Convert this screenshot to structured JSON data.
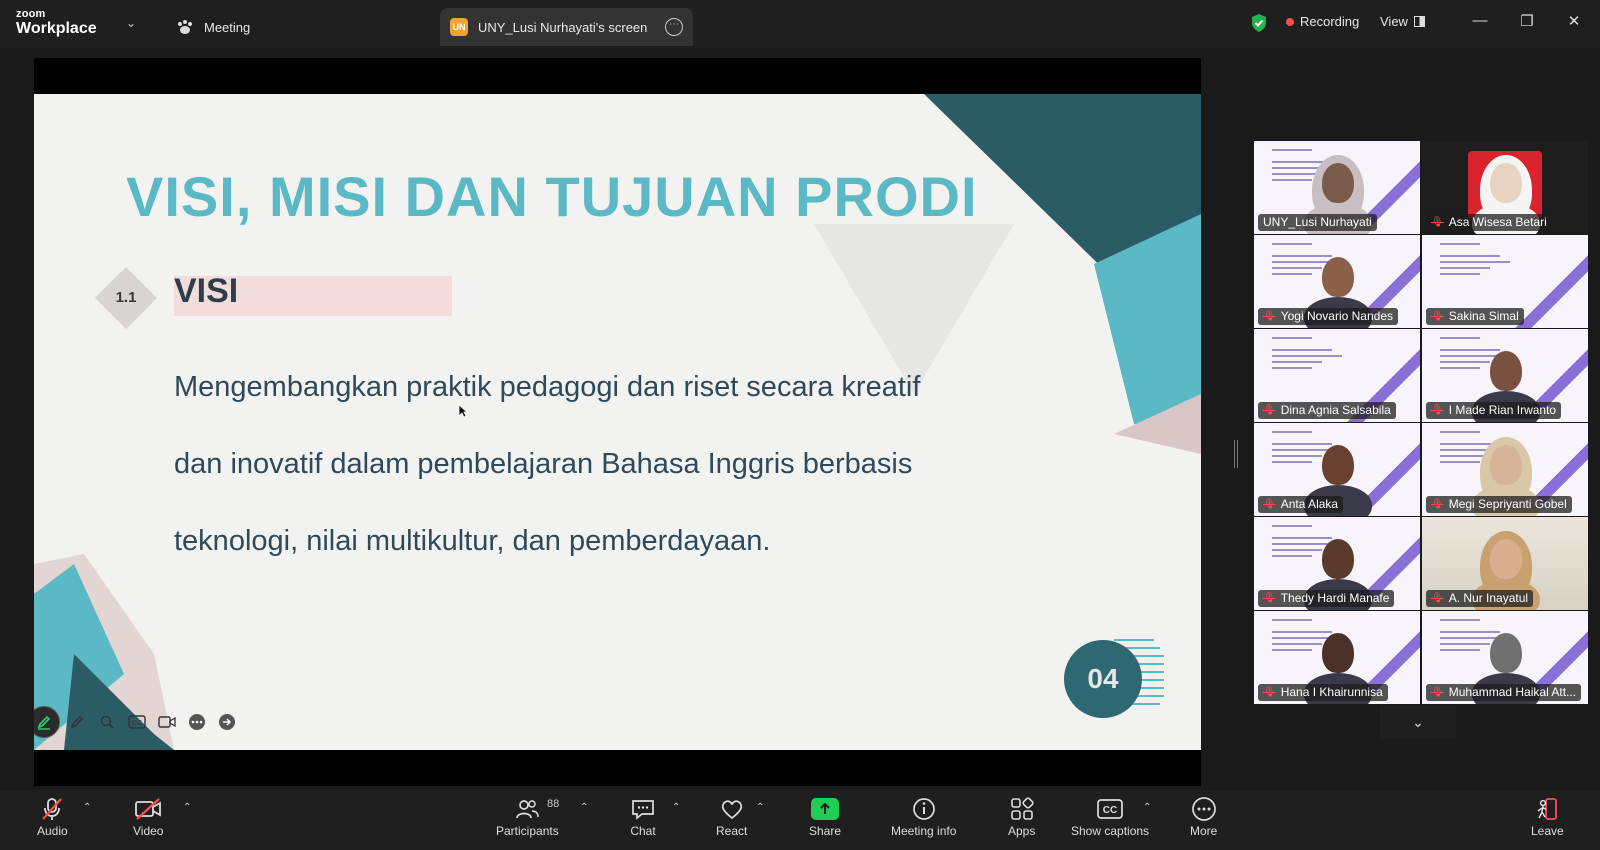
{
  "app": {
    "brand_top": "zoom",
    "brand_bottom": "Workplace"
  },
  "tabs": {
    "meeting": "Meeting",
    "screen_badge": "UN",
    "screen": "UNY_Lusi Nurhayati's screen"
  },
  "status": {
    "recording": "Recording",
    "view": "View"
  },
  "slide": {
    "title": "VISI, MISI DAN TUJUAN PRODI",
    "section_number": "1.1",
    "section_label": "VISI",
    "lines": [
      "Mengembangkan praktik pedagogi dan riset secara kreatif",
      "dan inovatif dalam pembelajaran Bahasa Inggris berbasis",
      "teknologi, nilai multikultur, dan pemberdayaan."
    ],
    "page_number": "04"
  },
  "participants": [
    {
      "name": "UNY_Lusi Nurhayati",
      "muted": false
    },
    {
      "name": "Asa Wisesa Betari",
      "muted": true
    },
    {
      "name": "Yogi Novario Nandes",
      "muted": true
    },
    {
      "name": "Sakina Simal",
      "muted": true
    },
    {
      "name": "Dina Agnia Salsabila",
      "muted": true
    },
    {
      "name": "I Made Rian Irwanto",
      "muted": true
    },
    {
      "name": "Anta Alaka",
      "muted": true
    },
    {
      "name": "Megi Sepriyanti Gobel",
      "muted": true
    },
    {
      "name": "Thedy Hardi Manafe",
      "muted": true
    },
    {
      "name": "A. Nur Inayatul",
      "muted": true
    },
    {
      "name": "Hana I Khairunnisa",
      "muted": true
    },
    {
      "name": "Muhammad Haikal Att...",
      "muted": true
    }
  ],
  "toolbar": {
    "audio": "Audio",
    "video": "Video",
    "participants": "Participants",
    "participants_count": "88",
    "chat": "Chat",
    "react": "React",
    "share": "Share",
    "meeting_info": "Meeting info",
    "apps": "Apps",
    "captions": "Show captions",
    "more": "More",
    "leave": "Leave"
  },
  "colors": {
    "accent": "#5ab9c4",
    "active_speaker": "#2fd26b",
    "share_green": "#1fcf55",
    "mute_red": "#ff4d4d"
  }
}
